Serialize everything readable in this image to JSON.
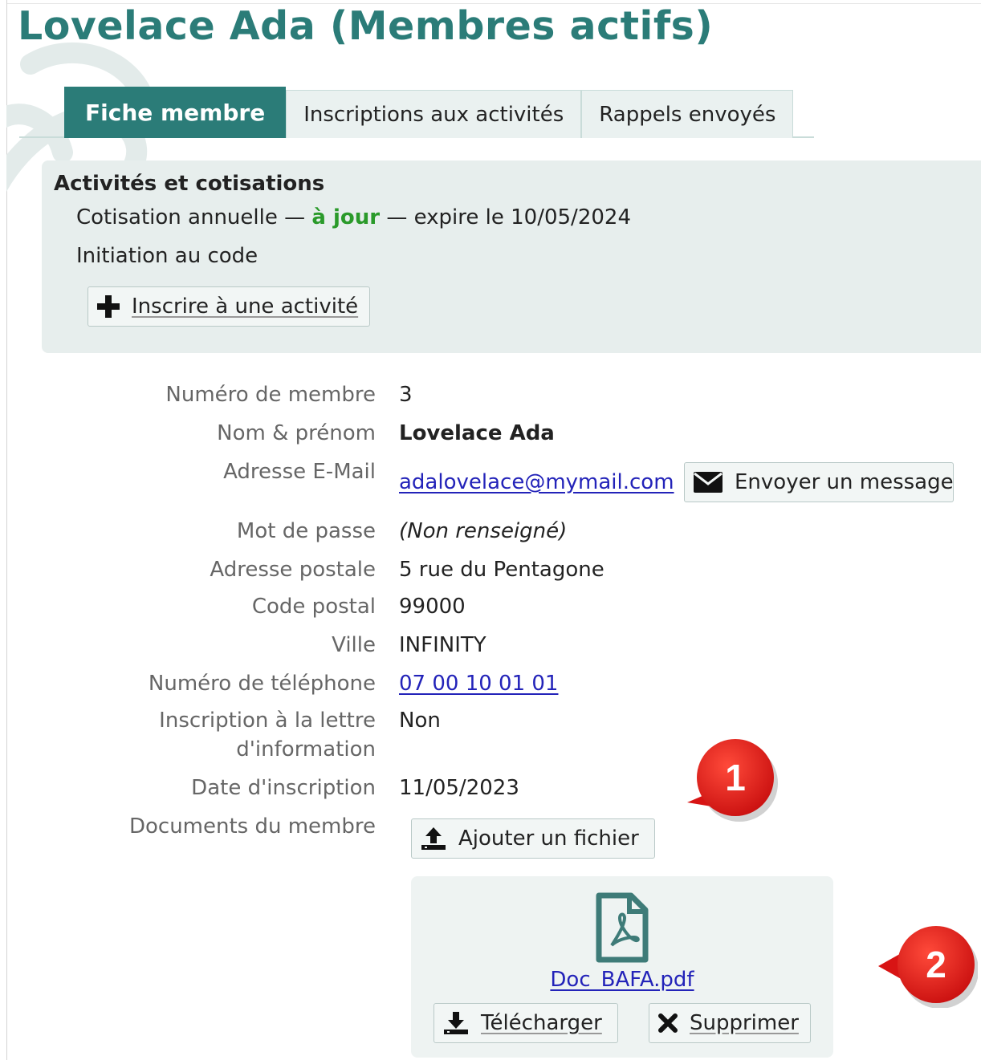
{
  "page": {
    "title": "Lovelace Ada (Membres actifs)"
  },
  "tabs": [
    {
      "label": "Fiche membre",
      "active": true
    },
    {
      "label": "Inscriptions aux activités",
      "active": false
    },
    {
      "label": "Rappels envoyés",
      "active": false
    }
  ],
  "activities": {
    "title": "Activités et cotisations",
    "subscription": {
      "name": "Cotisation annuelle",
      "sep1": " — ",
      "status": "à jour",
      "sep2": " — ",
      "expiry": "expire le 10/05/2024"
    },
    "activity": "Initiation au code",
    "enroll_button": "Inscrire à une activité"
  },
  "fields": {
    "member_number": {
      "label": "Numéro de membre",
      "value": "3"
    },
    "name": {
      "label": "Nom & prénom",
      "value": "Lovelace Ada"
    },
    "email": {
      "label": "Adresse E-Mail",
      "value": "adalovelace@mymail.com",
      "button": "Envoyer un message"
    },
    "password": {
      "label": "Mot de passe",
      "value": "(Non renseigné)"
    },
    "address": {
      "label": "Adresse postale",
      "value": "5 rue du Pentagone"
    },
    "postcode": {
      "label": "Code postal",
      "value": "99000"
    },
    "city": {
      "label": "Ville",
      "value": "INFINITY"
    },
    "phone": {
      "label": "Numéro de téléphone",
      "value": "07 00 10 01 01"
    },
    "newsletter": {
      "label_line1": "Inscription à la lettre",
      "label_line2": "d'information",
      "value": "Non"
    },
    "registration_date": {
      "label": "Date d'inscription",
      "value": "11/05/2023"
    },
    "documents": {
      "label": "Documents du membre",
      "add_button": "Ajouter un fichier"
    }
  },
  "file": {
    "name": "Doc_BAFA.pdf",
    "download_button": "Télécharger",
    "delete_button": "Supprimer"
  },
  "annotations": [
    {
      "number": "1"
    },
    {
      "number": "2"
    }
  ],
  "colors": {
    "accent": "#2b7c78",
    "status_ok": "#2a9a2a",
    "link": "#2323b9",
    "annotation": "#e01818"
  }
}
